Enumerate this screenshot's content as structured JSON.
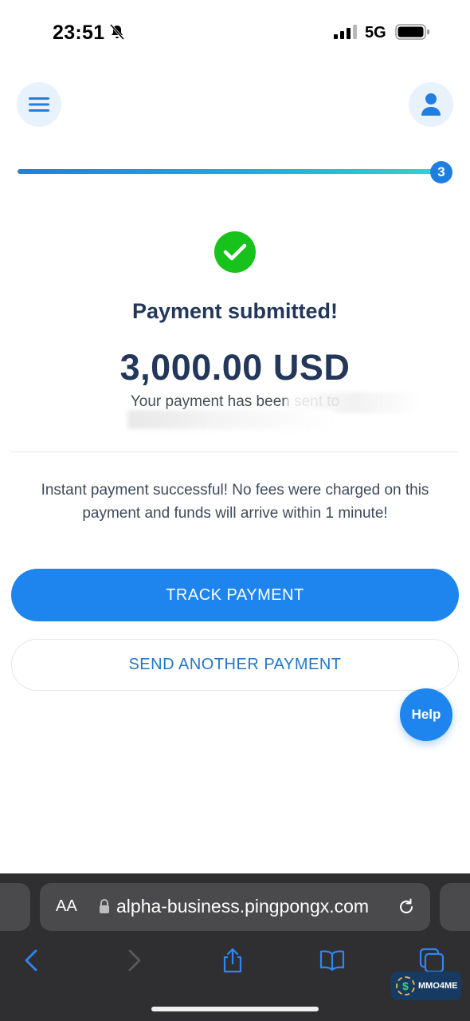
{
  "status_bar": {
    "time": "23:51",
    "network": "5G"
  },
  "progress": {
    "step": "3",
    "fill_fraction": 1.0
  },
  "confirmation": {
    "title": "Payment submitted!",
    "amount": "3,000.00 USD",
    "sent_to_prefix": "Your payment has been sent to",
    "note": "Instant payment successful! No fees were charged on this payment and funds will arrive within 1 minute!"
  },
  "actions": {
    "track_label": "TRACK PAYMENT",
    "send_another_label": "SEND ANOTHER PAYMENT",
    "help_label": "Help"
  },
  "browser": {
    "text_size_label": "AA",
    "url": "alpha-business.pingpongx.com"
  },
  "watermark": {
    "text": "MMO4ME",
    "symbol": "$"
  },
  "colors": {
    "primary": "#1e85ee",
    "success": "#17c21a",
    "title": "#23375a",
    "progress_end": "#2ed4cf"
  },
  "icons": [
    "menu-icon",
    "user-icon",
    "check-icon",
    "bell-slash-icon",
    "signal-icon",
    "battery-icon",
    "lock-icon",
    "reload-icon",
    "back-icon",
    "forward-icon",
    "share-icon",
    "bookmarks-icon",
    "tabs-icon"
  ]
}
